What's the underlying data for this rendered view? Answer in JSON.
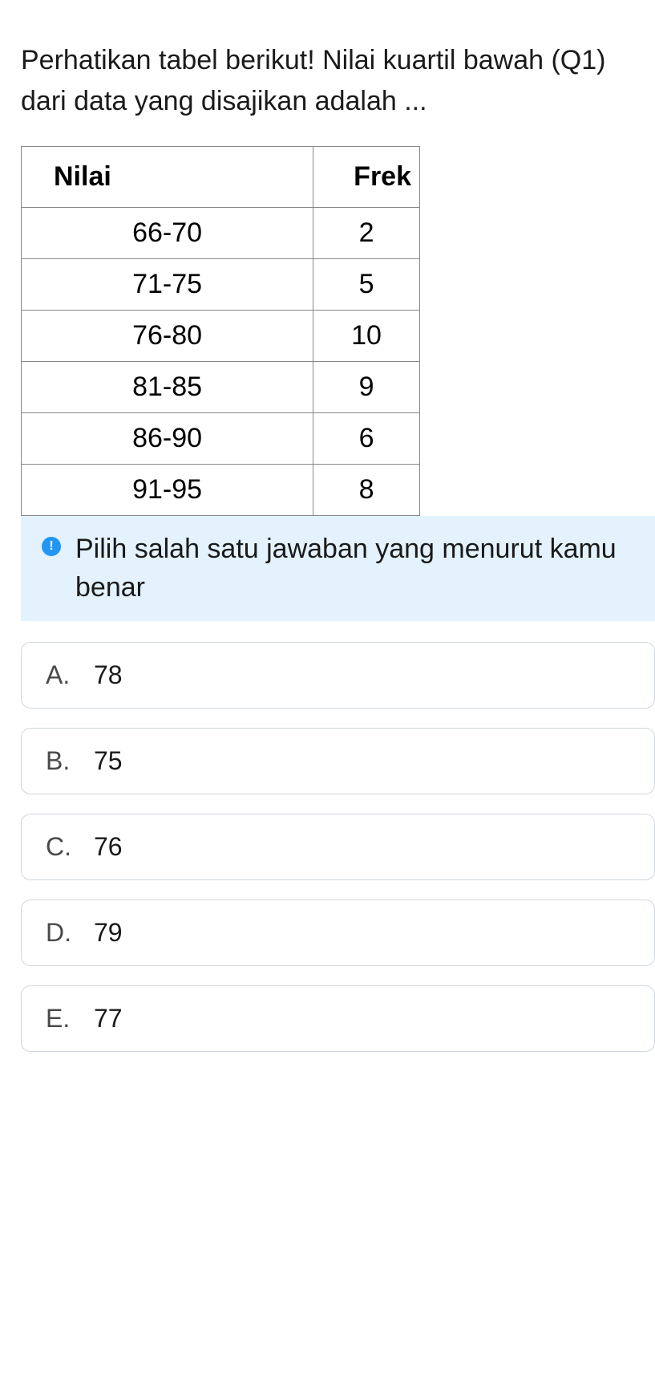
{
  "question": {
    "text": "Perhatikan tabel berikut! Nilai kuartil bawah (Q1) dari data yang disajikan adalah ..."
  },
  "table": {
    "headers": {
      "col1": "Nilai",
      "col2": "Frek"
    },
    "rows": [
      {
        "nilai": "66-70",
        "frek": "2"
      },
      {
        "nilai": "71-75",
        "frek": "5"
      },
      {
        "nilai": "76-80",
        "frek": "10"
      },
      {
        "nilai": "81-85",
        "frek": "9"
      },
      {
        "nilai": "86-90",
        "frek": "6"
      },
      {
        "nilai": "91-95",
        "frek": "8"
      }
    ]
  },
  "info": {
    "text": "Pilih salah satu jawaban yang menurut kamu benar",
    "icon_label": "!"
  },
  "options": [
    {
      "letter": "A.",
      "value": "78"
    },
    {
      "letter": "B.",
      "value": "75"
    },
    {
      "letter": "C.",
      "value": "76"
    },
    {
      "letter": "D.",
      "value": "79"
    },
    {
      "letter": "E.",
      "value": "77"
    }
  ]
}
